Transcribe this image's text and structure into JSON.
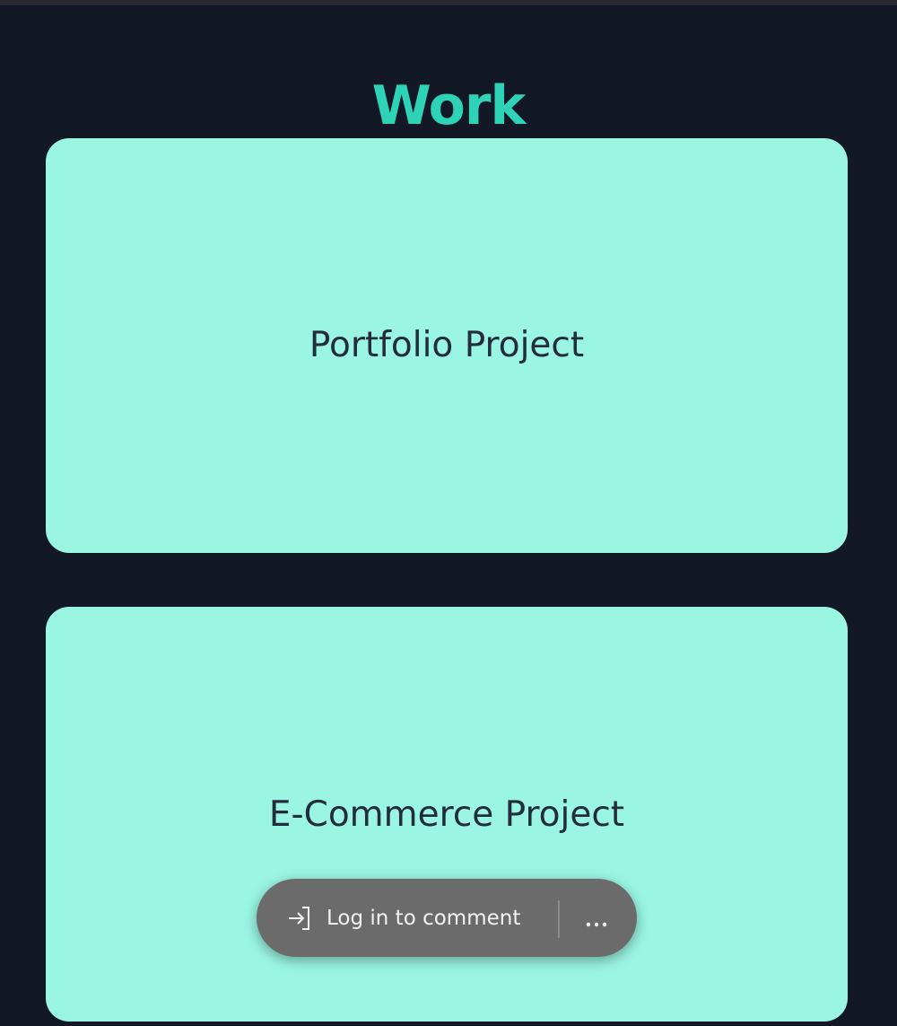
{
  "page": {
    "title": "Work"
  },
  "projects": [
    {
      "label": "Portfolio Project"
    },
    {
      "label": "E-Commerce Project"
    }
  ],
  "comment_bar": {
    "login_label": "Log in to comment",
    "login_icon": "sign-in-icon",
    "more_icon": "more-dots-icon"
  },
  "colors": {
    "background": "#121826",
    "title": "#2ed3b7",
    "card": "#9af5e3",
    "card_text": "#232c3b",
    "comment_bar": "#6b6b6b"
  }
}
